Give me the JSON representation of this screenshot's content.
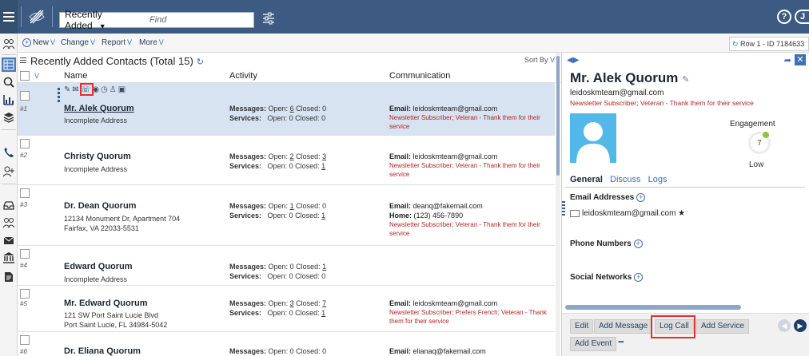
{
  "topbar": {
    "search_mode": "Recently Added",
    "search_placeholder": "Find",
    "help_label": "?",
    "user_initial": "J"
  },
  "toolbar": {
    "new_label": "New",
    "change_label": "Change",
    "report_label": "Report",
    "more_label": "More",
    "row_info": "Row 1 - ID 7184633"
  },
  "list": {
    "title": "Recently Added Contacts (Total 15)",
    "sort_label": "Sort By",
    "columns": {
      "name": "Name",
      "activity": "Activity",
      "communication": "Communication"
    },
    "rows": [
      {
        "num": "#1",
        "name": "Mr. Alek Quorum",
        "addr1": "Incomplete Address",
        "addr2": "",
        "addr3": "",
        "msg_open": "6",
        "msg_closed": "0",
        "svc_open": "0",
        "svc_closed": "0",
        "email": "leidoskmteam@gmail.com",
        "home": "",
        "note": "Newsletter Subscriber; Veteran - Thank them for their service"
      },
      {
        "num": "#2",
        "name": "Christy Quorum",
        "addr1": "Incomplete Address",
        "addr2": "",
        "addr3": "",
        "msg_open": "2",
        "msg_closed": "3",
        "svc_open": "0",
        "svc_closed": "1",
        "email": "leidoskmteam@gmail.com",
        "home": "",
        "note": "Newsletter Subscriber; Veteran - Thank them for their service"
      },
      {
        "num": "#3",
        "name": "Dr. Dean Quorum",
        "addr1": "12134 Monument Dr, Apartment 704",
        "addr2": "Fairfax, VA 22033-5531",
        "addr3": "",
        "msg_open": "1",
        "msg_closed": "0",
        "svc_open": "0",
        "svc_closed": "1",
        "email": "deanq@fakemail.com",
        "home": "(123) 456-7890",
        "note": "Newsletter Subscriber; Veteran - Thank them for their service"
      },
      {
        "num": "#4",
        "name": "Edward Quorum",
        "addr1": "Incomplete Address",
        "addr2": "",
        "addr3": "",
        "msg_open": "0",
        "msg_closed": "1",
        "svc_open": "0",
        "svc_closed": "0",
        "email": "",
        "home": "",
        "note": ""
      },
      {
        "num": "#5",
        "name": "Mr. Edward Quorum",
        "addr1": "121 SW Port Saint Lucie Blvd",
        "addr2": "Port Saint Lucie, FL 34984-5042",
        "addr3": "",
        "msg_open": "3",
        "msg_closed": "7",
        "svc_open": "0",
        "svc_closed": "1",
        "email": "leidoskmteam@gmail.com",
        "home": "",
        "note": "Newsletter Subscriber; Prefers French; Veteran - Thank them for their service"
      },
      {
        "num": "#6",
        "name": "Dr. Eliana Quorum",
        "addr1": "",
        "addr2": "",
        "addr3": "",
        "msg_open": "0",
        "msg_closed": "0",
        "svc_open": "",
        "svc_closed": "",
        "email": "elianaq@fakemail.com",
        "home": "",
        "note": ""
      }
    ],
    "labels": {
      "messages": "Messages:",
      "services": "Services:",
      "open": "Open:",
      "closed": "Closed:",
      "email": "Email:",
      "home": "Home:"
    }
  },
  "detail": {
    "name": "Mr. Alek Quorum",
    "email": "leidoskmteam@gmail.com",
    "note": "Newsletter Subscriber; Veteran - Thank them for their service",
    "engagement_label": "Engagement",
    "engagement_value": "7",
    "engagement_level": "Low",
    "tabs": [
      "General",
      "Discuss",
      "Logs"
    ],
    "sections": {
      "email_addresses": "Email Addresses",
      "phone_numbers": "Phone Numbers",
      "social_networks": "Social Networks"
    },
    "primary_email": "leidoskmteam@gmail.com ★",
    "actions": [
      "Edit",
      "Add Message",
      "Log Call",
      "Add Service",
      "Add Event",
      "▪▪▪"
    ]
  },
  "colors": {
    "accent": "#3d6fb5",
    "topbar": "#3d5b82",
    "highlight": "#e03030",
    "note": "#b02525"
  }
}
